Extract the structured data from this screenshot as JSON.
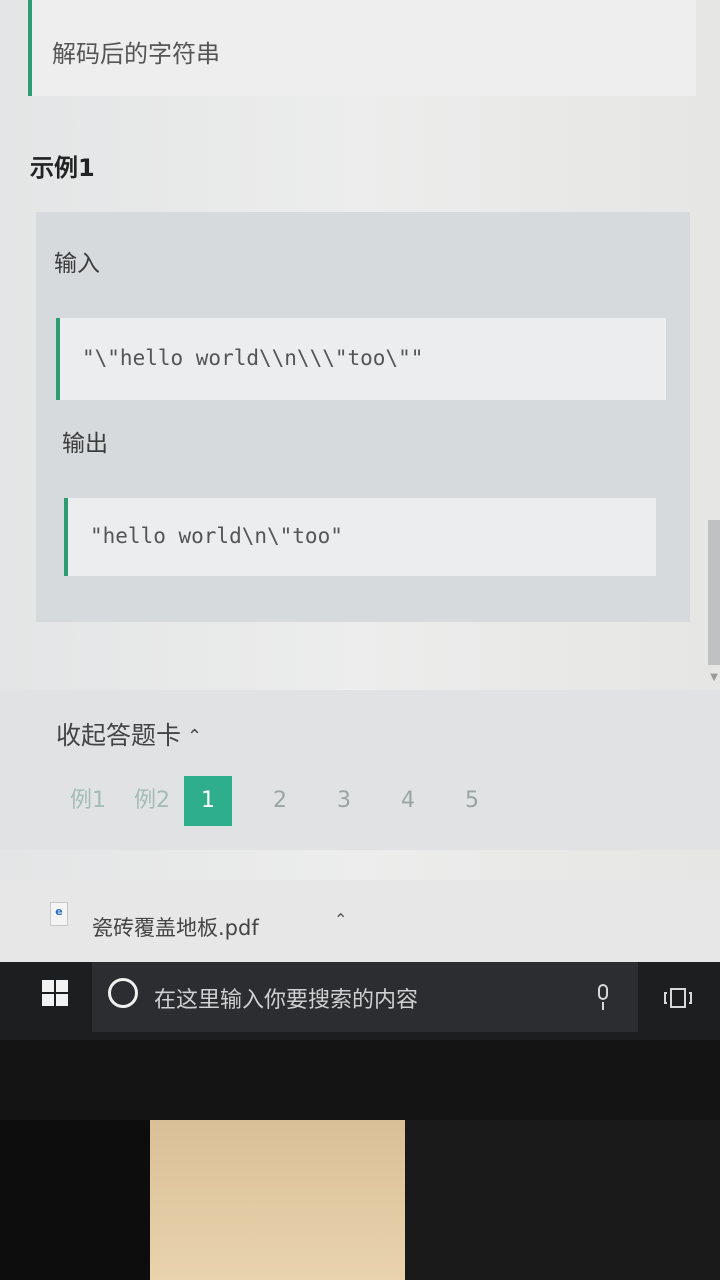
{
  "problem": {
    "output_description": "解码后的字符串",
    "example_title": "示例1",
    "input_label": "输入",
    "input_value": "\"\\\"hello world\\\\n\\\\\\\"too\\\"\"",
    "output_label": "输出",
    "output_value": "\"hello world\\n\\\"too\""
  },
  "answer_card": {
    "collapse_label": "收起答题卡",
    "collapse_icon": "chevron-up-icon",
    "items": [
      {
        "label": "例1",
        "kind": "example"
      },
      {
        "label": "例2",
        "kind": "example"
      },
      {
        "label": "1",
        "kind": "question",
        "active": true
      },
      {
        "label": "2",
        "kind": "question"
      },
      {
        "label": "3",
        "kind": "question"
      },
      {
        "label": "4",
        "kind": "question"
      },
      {
        "label": "5",
        "kind": "question"
      }
    ],
    "accent_color": "#2fae8b"
  },
  "download_bar": {
    "file_name": "瓷砖覆盖地板.pdf",
    "file_icon": "pdf-file-icon",
    "toggle_icon": "chevron-up-icon"
  },
  "taskbar": {
    "start_icon": "windows-logo-icon",
    "search_placeholder": "在这里输入你要搜索的内容",
    "cortana_icon": "cortana-circle-icon",
    "mic_icon": "microphone-icon",
    "taskview_icon": "task-view-icon"
  },
  "colors": {
    "accent_green": "#2e9c72",
    "taskbar_bg": "#1c1e20"
  }
}
